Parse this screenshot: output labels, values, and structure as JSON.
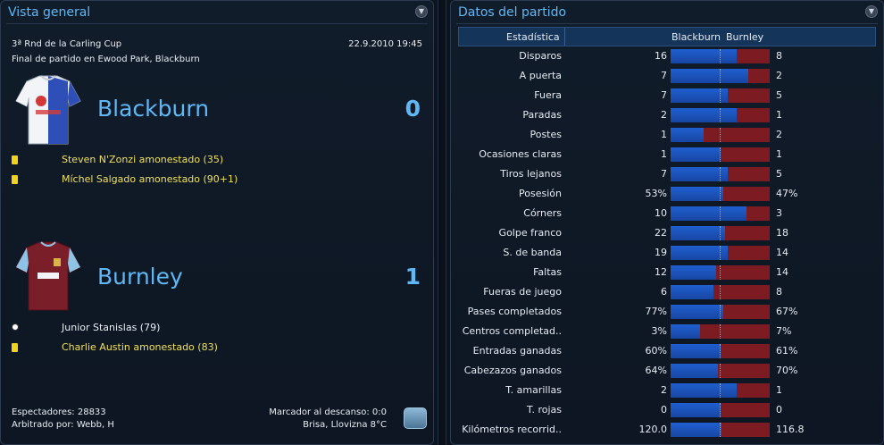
{
  "left_panel": {
    "title": "Vista general",
    "competition": "3ª Rnd de la Carling Cup",
    "datetime": "22.9.2010 19:45",
    "venue": "Final de partido en Ewood Park, Blackburn",
    "home": {
      "name": "Blackburn",
      "score": "0",
      "events": [
        {
          "type": "yellow-card",
          "text": "Steven N'Zonzi amonestado (35)"
        },
        {
          "type": "yellow-card",
          "text": "Míchel Salgado amonestado (90+1)"
        }
      ]
    },
    "away": {
      "name": "Burnley",
      "score": "1",
      "events": [
        {
          "type": "goal",
          "text": "Junior Stanislas (79)"
        },
        {
          "type": "yellow-card",
          "text": "Charlie Austin amonestado (83)"
        }
      ]
    },
    "footer": {
      "attendance": "Espectadores: 28833",
      "referee": "Arbitrado por: Webb, H",
      "halftime": "Marcador al descanso: 0:0",
      "weather": "Brisa, Llovizna 8°C"
    }
  },
  "right_panel": {
    "title": "Datos del partido",
    "header": {
      "stat": "Estadística",
      "home": "Blackburn",
      "away": "Burnley"
    },
    "stats": [
      {
        "label": "Disparos",
        "home": "16",
        "away": "8",
        "home_share": 0.67
      },
      {
        "label": "A puerta",
        "home": "7",
        "away": "2",
        "home_share": 0.78
      },
      {
        "label": "Fuera",
        "home": "7",
        "away": "5",
        "home_share": 0.58
      },
      {
        "label": "Paradas",
        "home": "2",
        "away": "1",
        "home_share": 0.67
      },
      {
        "label": "Postes",
        "home": "1",
        "away": "2",
        "home_share": 0.33
      },
      {
        "label": "Ocasiones claras",
        "home": "1",
        "away": "1",
        "home_share": 0.5
      },
      {
        "label": "Tiros lejanos",
        "home": "7",
        "away": "5",
        "home_share": 0.58
      },
      {
        "label": "Posesión",
        "home": "53%",
        "away": "47%",
        "home_share": 0.53
      },
      {
        "label": "Córners",
        "home": "10",
        "away": "3",
        "home_share": 0.77
      },
      {
        "label": "Golpe franco",
        "home": "22",
        "away": "18",
        "home_share": 0.55
      },
      {
        "label": "S. de banda",
        "home": "19",
        "away": "14",
        "home_share": 0.58
      },
      {
        "label": "Faltas",
        "home": "12",
        "away": "14",
        "home_share": 0.46
      },
      {
        "label": "Fueras de juego",
        "home": "6",
        "away": "8",
        "home_share": 0.43
      },
      {
        "label": "Pases completados",
        "home": "77%",
        "away": "67%",
        "home_share": 0.53
      },
      {
        "label": "Centros completad..",
        "home": "3%",
        "away": "7%",
        "home_share": 0.3
      },
      {
        "label": "Entradas ganadas",
        "home": "60%",
        "away": "61%",
        "home_share": 0.5
      },
      {
        "label": "Cabezazos ganados",
        "home": "64%",
        "away": "70%",
        "home_share": 0.48
      },
      {
        "label": "T. amarillas",
        "home": "2",
        "away": "1",
        "home_share": 0.67
      },
      {
        "label": "T. rojas",
        "home": "0",
        "away": "0",
        "home_share": 0.5
      },
      {
        "label": "Kilómetros recorrid..",
        "home": "120.0",
        "away": "116.8",
        "home_share": 0.51
      }
    ]
  }
}
